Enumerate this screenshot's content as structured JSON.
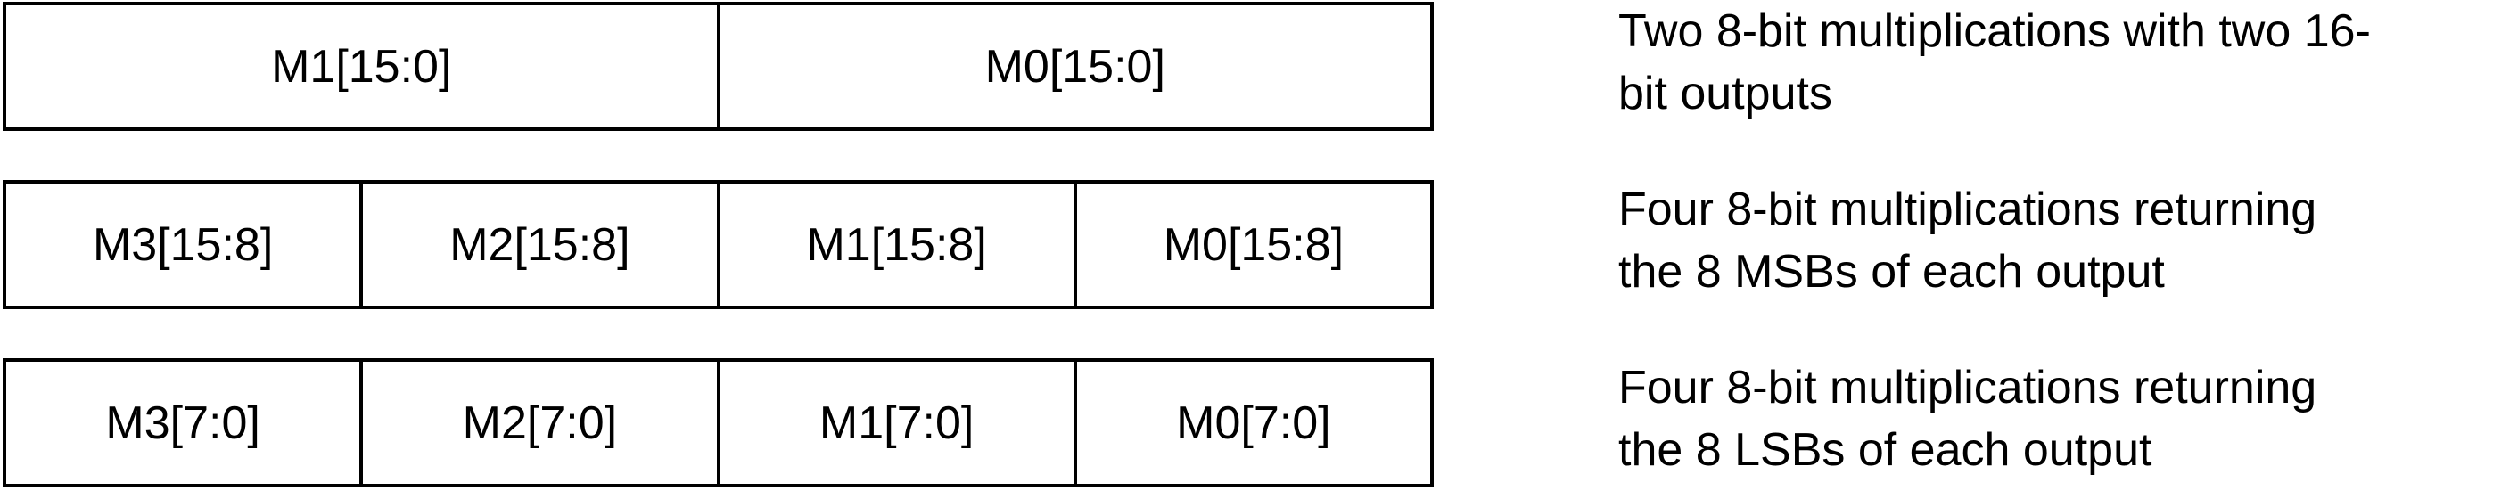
{
  "rows": [
    {
      "cells": [
        "M1[15:0]",
        "M0[15:0]"
      ],
      "description": [
        "Two 8-bit multiplications with two 16-",
        "bit outputs"
      ]
    },
    {
      "cells": [
        "M3[15:8]",
        "M2[15:8]",
        "M1[15:8]",
        "M0[15:8]"
      ],
      "description": [
        "Four 8-bit multiplications returning",
        "the 8 MSBs of each output"
      ]
    },
    {
      "cells": [
        "M3[7:0]",
        "M2[7:0]",
        "M1[7:0]",
        "M0[7:0]"
      ],
      "description": [
        "Four 8-bit multiplications returning",
        "the 8 LSBs of each output"
      ]
    }
  ]
}
